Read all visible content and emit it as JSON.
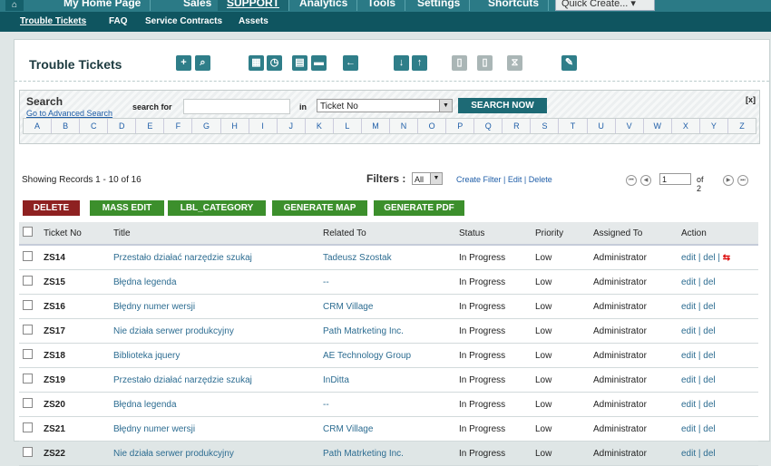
{
  "topnav": {
    "tabs": [
      "My Home Page",
      "Sales",
      "SUPPORT",
      "Analytics",
      "Tools",
      "Settings",
      "Shortcuts"
    ],
    "quick_create": "Quick Create..."
  },
  "subnav": {
    "items": [
      "Trouble Tickets",
      "FAQ",
      "Service Contracts",
      "Assets"
    ]
  },
  "page_title": "Trouble Tickets",
  "search": {
    "label": "Search",
    "advanced_link": "Go to Advanced Search",
    "for_label": "search for",
    "in_label": "in",
    "field_value": "Ticket No",
    "button": "SEARCH NOW",
    "close": "[x]",
    "alphabet": [
      "A",
      "B",
      "C",
      "D",
      "E",
      "F",
      "G",
      "H",
      "I",
      "J",
      "K",
      "L",
      "M",
      "N",
      "O",
      "P",
      "Q",
      "R",
      "S",
      "T",
      "U",
      "V",
      "W",
      "X",
      "Y",
      "Z"
    ]
  },
  "records_info": "Showing Records 1 - 10 of 16",
  "filters": {
    "label": "Filters :",
    "selected": "All",
    "links": "Create Filter | Edit | Delete"
  },
  "pager": {
    "page": "1",
    "of_text": "of 2"
  },
  "buttons": {
    "delete": "DELETE",
    "mass_edit": "MASS EDIT",
    "category": "LBL_CATEGORY",
    "map": "GENERATE MAP",
    "pdf": "GENERATE PDF"
  },
  "table": {
    "headers": [
      "Ticket No",
      "Title",
      "Related To",
      "Status",
      "Priority",
      "Assigned To",
      "Action"
    ],
    "rows": [
      [
        "ZS14",
        "Przestało działać narzędzie szukaj",
        "Tadeusz Szostak",
        "In Progress",
        "Low",
        "Administrator",
        "edit | del |"
      ],
      [
        "ZS15",
        "Błędna legenda",
        "--",
        "In Progress",
        "Low",
        "Administrator",
        "edit | del"
      ],
      [
        "ZS16",
        "Błędny numer wersji",
        "CRM Village",
        "In Progress",
        "Low",
        "Administrator",
        "edit | del"
      ],
      [
        "ZS17",
        "Nie działa serwer produkcyjny",
        "Path Matrketing Inc.",
        "In Progress",
        "Low",
        "Administrator",
        "edit | del"
      ],
      [
        "ZS18",
        "Biblioteka jquery",
        "AE Technology Group",
        "In Progress",
        "Low",
        "Administrator",
        "edit | del"
      ],
      [
        "ZS19",
        "Przestało działać narzędzie szukaj",
        "InDitta",
        "In Progress",
        "Low",
        "Administrator",
        "edit | del"
      ],
      [
        "ZS20",
        "Błędna legenda",
        "--",
        "In Progress",
        "Low",
        "Administrator",
        "edit | del"
      ],
      [
        "ZS21",
        "Błędny numer wersji",
        "CRM Village",
        "In Progress",
        "Low",
        "Administrator",
        "edit | del"
      ],
      [
        "ZS22",
        "Nie działa serwer produkcyjny",
        "Path Matrketing Inc.",
        "In Progress",
        "Low",
        "Administrator",
        "edit | del"
      ]
    ]
  }
}
